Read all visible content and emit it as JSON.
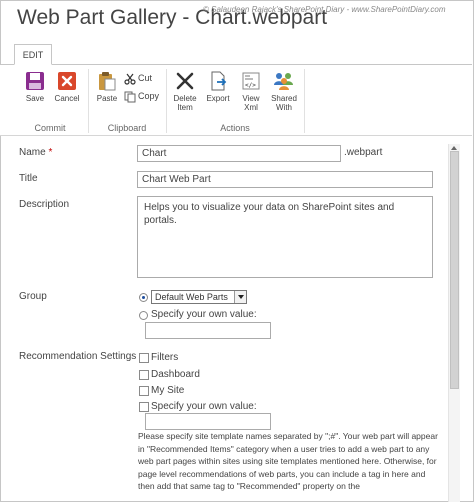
{
  "window": {
    "title": "Web Part Gallery - Chart.webpart",
    "watermark": "© Salaudeen Rajack's SharePoint Diary - www.SharePointDiary.com"
  },
  "ribbon": {
    "tab": "EDIT",
    "groups": [
      {
        "label": "Commit",
        "buttons": [
          {
            "label": "Save",
            "icon": "save-icon"
          },
          {
            "label": "Cancel",
            "icon": "cancel-icon"
          }
        ]
      },
      {
        "label": "Clipboard",
        "buttons": [
          {
            "label": "Paste",
            "icon": "paste-icon"
          },
          {
            "label": "Cut",
            "icon": "cut-icon"
          },
          {
            "label": "Copy",
            "icon": "copy-icon"
          }
        ]
      },
      {
        "label": "Actions",
        "buttons": [
          {
            "label1": "Delete",
            "label2": "Item",
            "icon": "delete-icon"
          },
          {
            "label1": "Export",
            "label2": "",
            "icon": "export-icon"
          },
          {
            "label1": "View",
            "label2": "Xml",
            "icon": "view-xml-icon"
          },
          {
            "label1": "Shared",
            "label2": "With",
            "icon": "shared-with-icon"
          }
        ]
      }
    ]
  },
  "form": {
    "name": {
      "label": "Name",
      "required": "*",
      "value": "Chart",
      "suffix": ".webpart"
    },
    "title": {
      "label": "Title",
      "value": "Chart Web Part"
    },
    "description": {
      "label": "Description",
      "value": "Helps you to visualize your data on SharePoint sites and portals."
    },
    "group": {
      "label": "Group",
      "selected_option": "Default Web Parts",
      "custom_label": "Specify your own value:",
      "custom_value": ""
    },
    "recommendation": {
      "label": "Recommendation Settings",
      "options": [
        "Filters",
        "Dashboard",
        "My Site",
        "Specify your own value:"
      ],
      "custom_value": "",
      "help": "Please specify site template names separated by \";#\". Your web part will appear in \"Recommended Items\" category when a user tries to add a web part to any web part pages within sites using site templates mentioned here. Otherwise, for page level recommendations of web parts, you can include a tag in here and then add that same tag to \"Recommended\" property on the"
    }
  },
  "colors": {
    "accent": "#1d4e9e",
    "required": "#bf0000",
    "cancel_red": "#d9472b",
    "save_purple": "#8a2d8f"
  }
}
